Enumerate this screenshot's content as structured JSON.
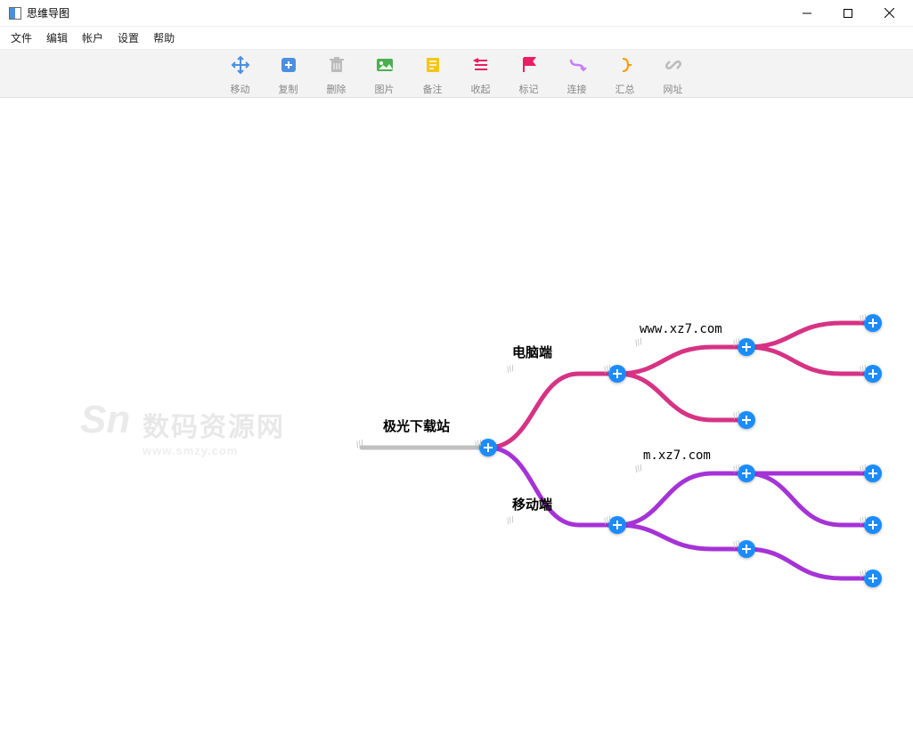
{
  "window": {
    "title": "思维导图"
  },
  "menus": {
    "file": "文件",
    "edit": "编辑",
    "account": "帐户",
    "settings": "设置",
    "help": "帮助"
  },
  "toolbar": {
    "move": "移动",
    "copy": "复制",
    "delete": "删除",
    "image": "图片",
    "note": "备注",
    "collapse": "收起",
    "mark": "标记",
    "link": "连接",
    "summary": "汇总",
    "url": "网址"
  },
  "watermark": {
    "text_big": "数码资源网",
    "text_small": "www.smzy.com"
  },
  "nodes": {
    "root": "极光下载站",
    "pc": "电脑端",
    "mobile": "移动端",
    "pc_url": "www.xz7.com",
    "mobile_url": "m.xz7.com"
  },
  "colors": {
    "pink": "#d63384",
    "purple": "#a533d6",
    "plus": "#1a8cff",
    "grey": "#c0c0c0"
  }
}
